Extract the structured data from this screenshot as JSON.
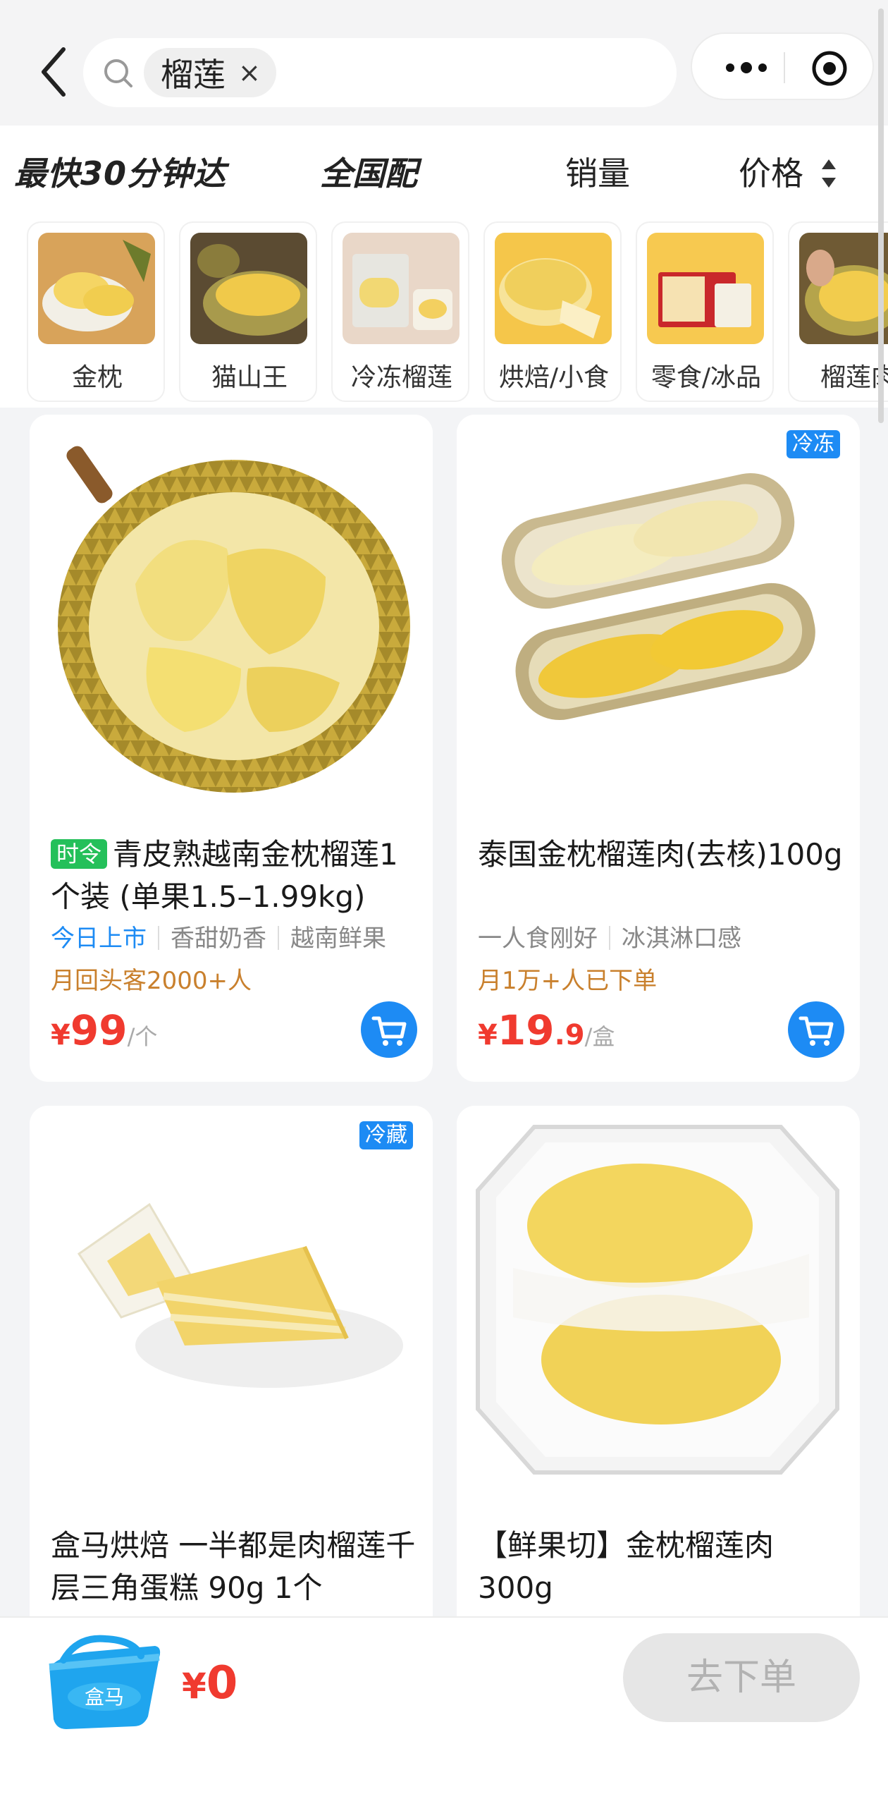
{
  "search": {
    "keyword": "榴莲",
    "clear": "×"
  },
  "filters": {
    "fast": "最快30分钟达",
    "national": "全国配",
    "sales": "销量",
    "price": "价格"
  },
  "categories": [
    {
      "label": "金枕"
    },
    {
      "label": "猫山王"
    },
    {
      "label": "冷冻榴莲"
    },
    {
      "label": "烘焙/小食"
    },
    {
      "label": "零食/冰品"
    },
    {
      "label": "榴莲肉"
    }
  ],
  "products": [
    {
      "badge": "时令",
      "title": "青皮熟越南金枕榴莲1个装 (单果1.5–1.99kg)",
      "features": [
        "今日上市",
        "香甜奶香",
        "越南鲜果"
      ],
      "sold": "月回头客2000+人",
      "price_symbol": "¥",
      "price_int": "99",
      "price_dec": "",
      "unit": "/个"
    },
    {
      "tag": "冷冻",
      "title": "泰国金枕榴莲肉(去核)100g",
      "features": [
        "一人食刚好",
        "冰淇淋口感"
      ],
      "sold": "月1万+人已下单",
      "price_symbol": "¥",
      "price_int": "19",
      "price_dec": ".9",
      "unit": "/盒"
    },
    {
      "tag": "冷藏",
      "title": "盒马烘焙 一半都是肉榴莲千层三角蛋糕 90g 1个"
    },
    {
      "title": "【鲜果切】金枕榴莲肉300g"
    }
  ],
  "cart": {
    "symbol": "¥",
    "total": "0",
    "order_label": "去下单",
    "basket_brand": "盒马"
  }
}
